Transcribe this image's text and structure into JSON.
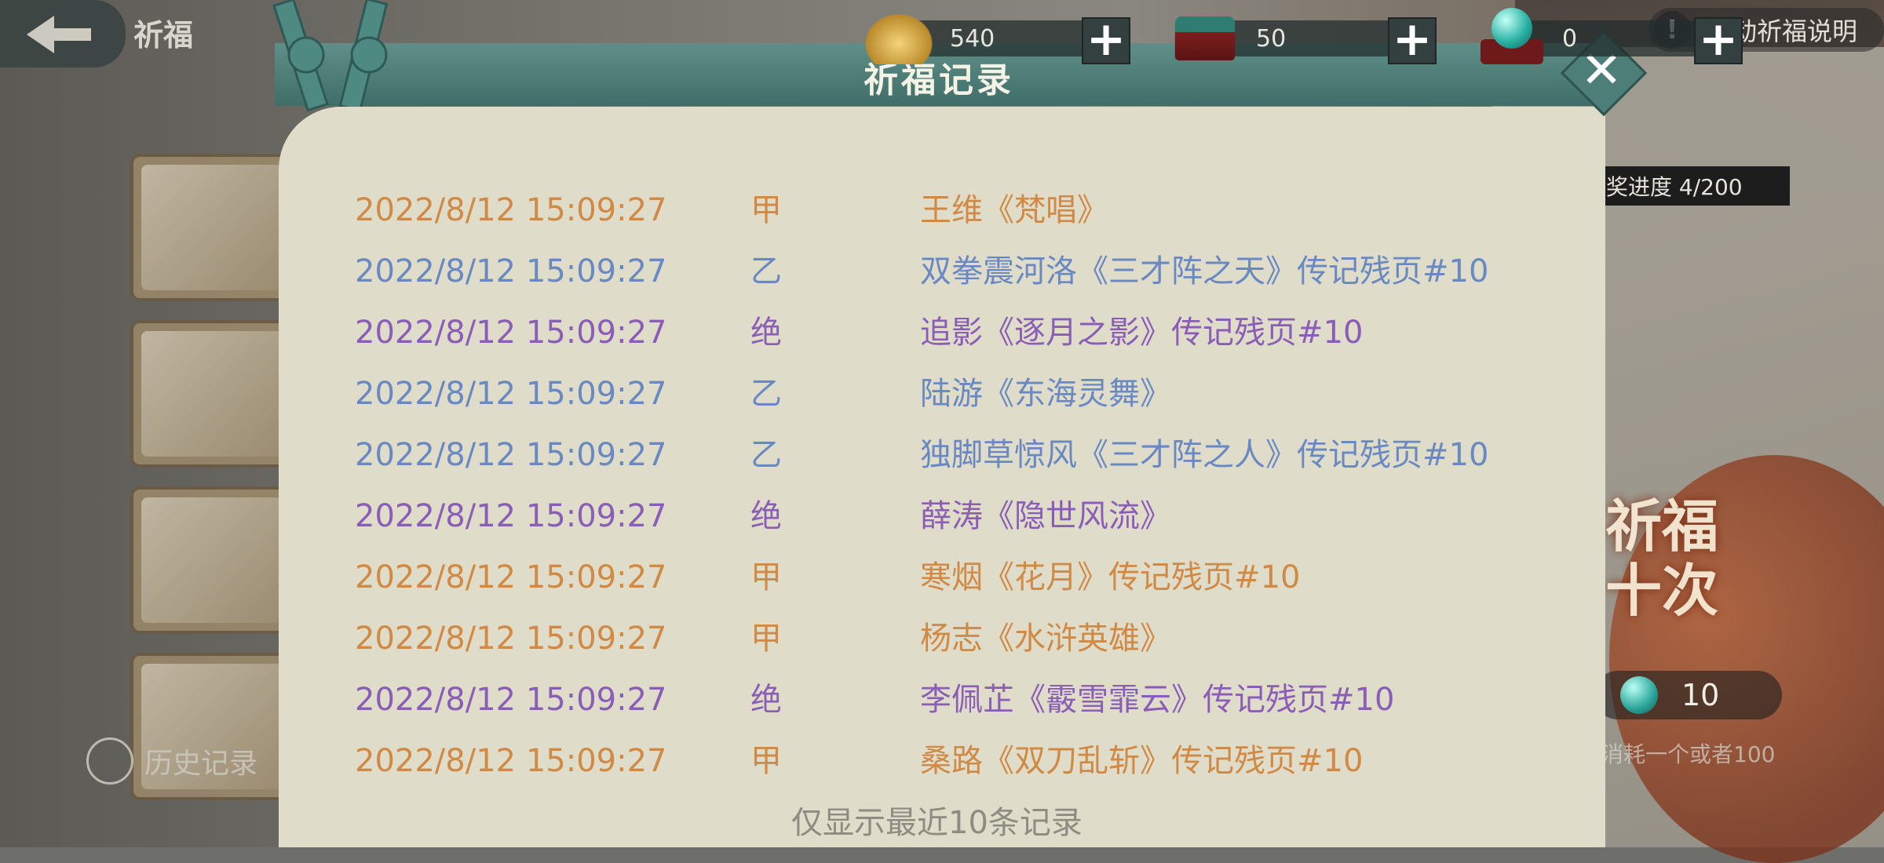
{
  "nav": {
    "title": "祈福"
  },
  "currencies": [
    {
      "name": "gold-ingot",
      "value": "540",
      "plus": "+"
    },
    {
      "name": "treasure-chest",
      "value": "50",
      "plus": "+"
    },
    {
      "name": "jade-orb",
      "value": "0",
      "plus": "+"
    }
  ],
  "help": {
    "icon": "!",
    "label": "活动祈福说明"
  },
  "progress": {
    "text": "奖进度 4/200"
  },
  "pray_button": {
    "line1": "祈福",
    "line2": "十次"
  },
  "cost": {
    "amount": "10",
    "note": "消耗一个或者100"
  },
  "history": {
    "label": "历史记录"
  },
  "modal": {
    "title": "祈福记录",
    "close": "✕",
    "footer": "仅显示最近10条记录",
    "colors": {
      "甲": "#d08a45",
      "乙": "#6a89c2",
      "绝": "#8a5db7"
    },
    "records": [
      {
        "time": "2022/8/12 15:09:27",
        "grade": "甲",
        "item": "王维《梵唱》"
      },
      {
        "time": "2022/8/12 15:09:27",
        "grade": "乙",
        "item": "双拳震河洛《三才阵之天》传记残页#10"
      },
      {
        "time": "2022/8/12 15:09:27",
        "grade": "绝",
        "item": "追影《逐月之影》传记残页#10"
      },
      {
        "time": "2022/8/12 15:09:27",
        "grade": "乙",
        "item": "陆游《东海灵舞》"
      },
      {
        "time": "2022/8/12 15:09:27",
        "grade": "乙",
        "item": "独脚草惊风《三才阵之人》传记残页#10"
      },
      {
        "time": "2022/8/12 15:09:27",
        "grade": "绝",
        "item": "薛涛《隐世风流》"
      },
      {
        "time": "2022/8/12 15:09:27",
        "grade": "甲",
        "item": "寒烟《花月》传记残页#10"
      },
      {
        "time": "2022/8/12 15:09:27",
        "grade": "甲",
        "item": "杨志《水浒英雄》"
      },
      {
        "time": "2022/8/12 15:09:27",
        "grade": "绝",
        "item": "李佩芷《霰雪霏云》传记残页#10"
      },
      {
        "time": "2022/8/12 15:09:27",
        "grade": "甲",
        "item": "桑路《双刀乱斩》传记残页#10"
      }
    ]
  }
}
